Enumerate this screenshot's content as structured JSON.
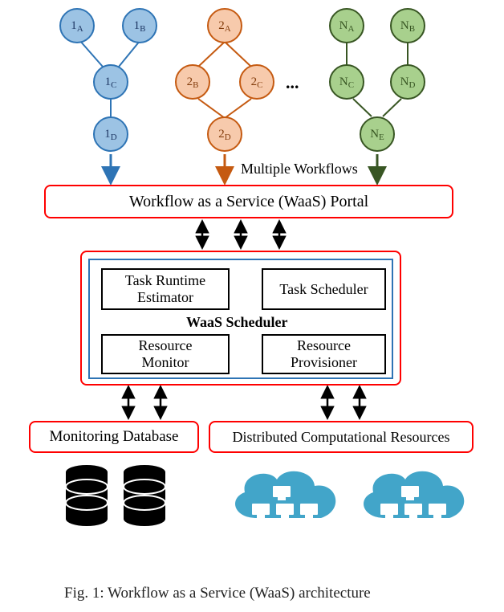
{
  "workflows": {
    "wf1": {
      "n1": "1",
      "n1s": "A",
      "n2": "1",
      "n2s": "B",
      "n3": "1",
      "n3s": "C",
      "n4": "1",
      "n4s": "D"
    },
    "wf2": {
      "n1": "2",
      "n1s": "A",
      "n2": "2",
      "n2s": "B",
      "n3": "2",
      "n3s": "C",
      "n4": "2",
      "n4s": "D"
    },
    "wfN": {
      "n1": "N",
      "n1s": "A",
      "n2": "N",
      "n2s": "B",
      "n3": "N",
      "n3s": "C",
      "n4": "N",
      "n4s": "D",
      "n5": "N",
      "n5s": "E"
    }
  },
  "labels": {
    "multiple_workflows": "Multiple Workflows",
    "ellipsis": "...",
    "portal": "Workflow as a Service (WaaS) Portal",
    "scheduler_title": "WaaS Scheduler",
    "task_runtime": "Task Runtime\nEstimator",
    "task_scheduler": "Task Scheduler",
    "resource_monitor": "Resource\nMonitor",
    "resource_provisioner": "Resource\nProvisioner",
    "monitoring_db": "Monitoring Database",
    "dcr": "Distributed Computational Resources",
    "caption": "Fig. 1: Workflow as a Service (WaaS) architecture"
  },
  "colors": {
    "blue": "#2e74b5",
    "orange": "#c55a11",
    "green": "#385623",
    "red": "#ff0000",
    "cloud": "#42a5c9"
  }
}
